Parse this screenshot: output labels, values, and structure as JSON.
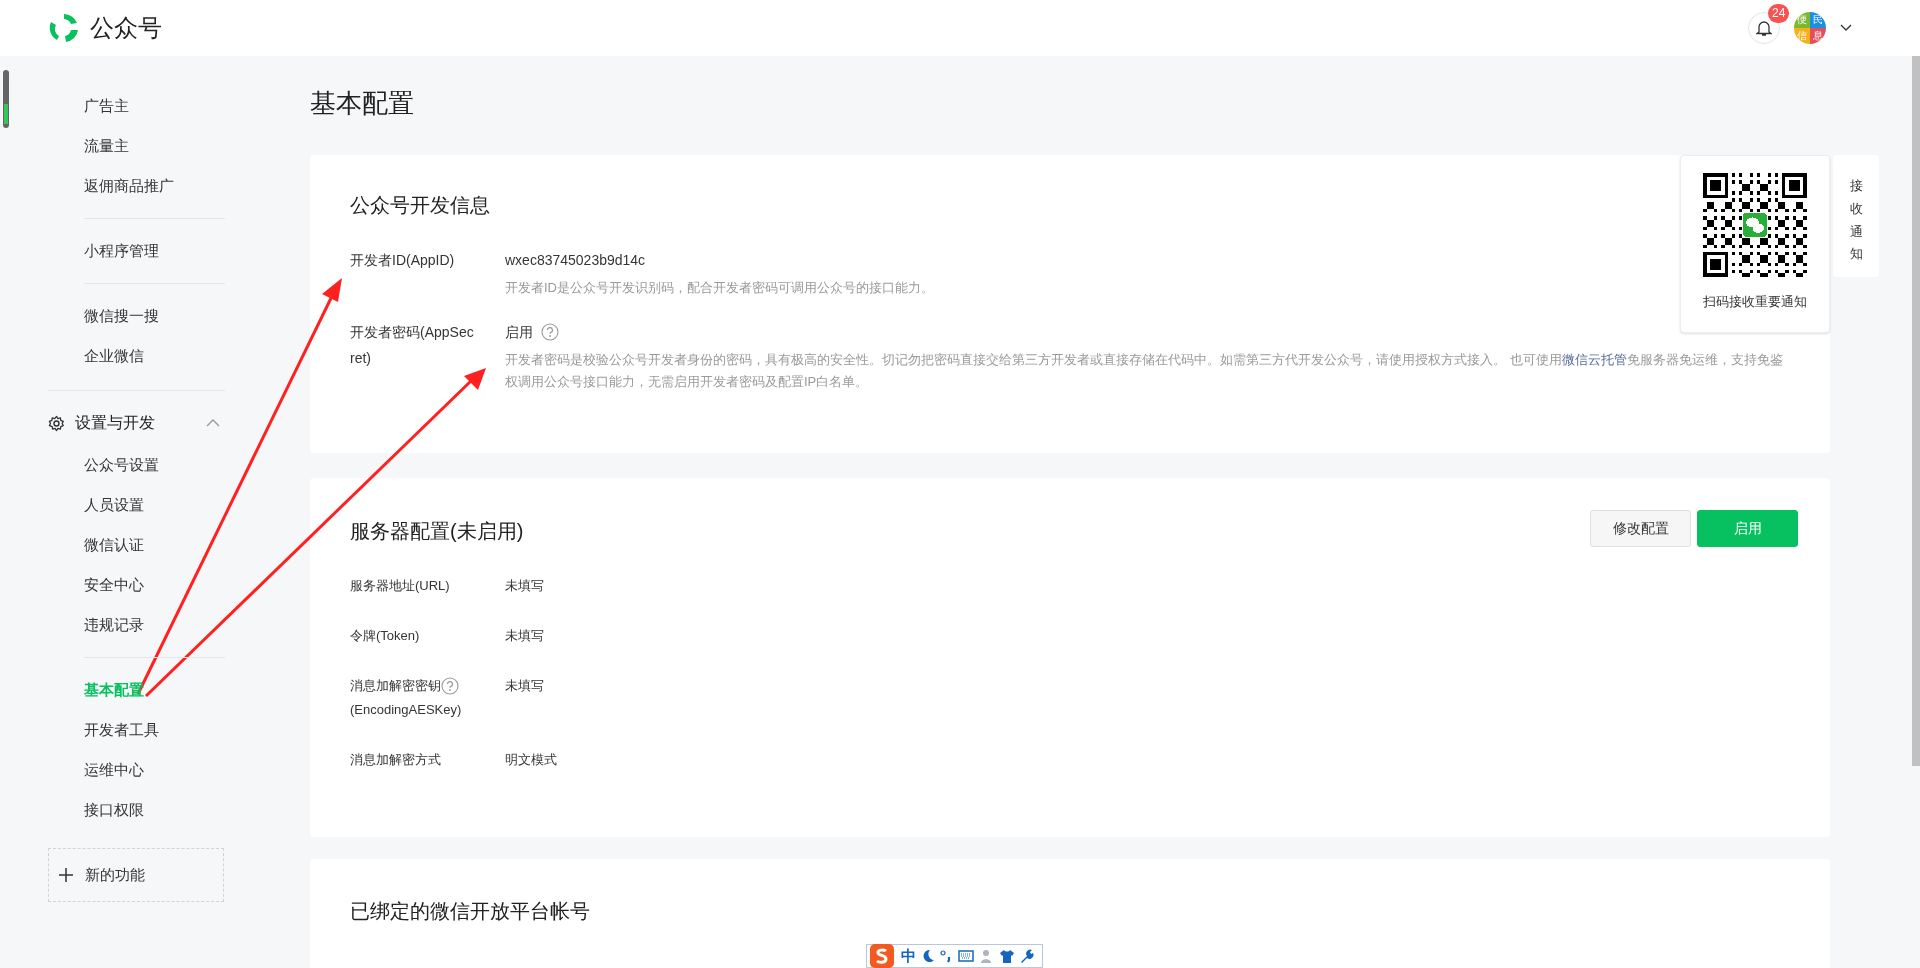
{
  "header": {
    "title": "公众号",
    "notification_count": "24",
    "avatar_chars": [
      "便",
      "民",
      "信",
      "息"
    ]
  },
  "sidebar": {
    "sections": [
      {
        "blocks": [
          [
            {
              "label": "广告主",
              "selected": false
            },
            {
              "label": "流量主",
              "selected": false
            },
            {
              "label": "返佣商品推广",
              "selected": false
            }
          ],
          [
            {
              "label": "小程序管理",
              "selected": false
            }
          ],
          [
            {
              "label": "微信搜一搜",
              "selected": false
            },
            {
              "label": "企业微信",
              "selected": false
            }
          ]
        ]
      },
      {
        "title": "设置与开发",
        "expanded": true,
        "blocks": [
          [
            {
              "label": "公众号设置",
              "selected": false
            },
            {
              "label": "人员设置",
              "selected": false
            },
            {
              "label": "微信认证",
              "selected": false
            },
            {
              "label": "安全中心",
              "selected": false
            },
            {
              "label": "违规记录",
              "selected": false
            }
          ],
          [
            {
              "label": "基本配置",
              "selected": true
            },
            {
              "label": "开发者工具",
              "selected": false
            },
            {
              "label": "运维中心",
              "selected": false
            },
            {
              "label": "接口权限",
              "selected": false
            }
          ]
        ]
      }
    ],
    "new_feature": "新的功能"
  },
  "page_title": "基本配置",
  "dev_info": {
    "title": "公众号开发信息",
    "fields": [
      {
        "label": "开发者ID(AppID)",
        "value": "wxec83745023b9d14c",
        "help": false,
        "description": [
          {
            "text": "开发者ID是公众号开发识别码，配合开发者密码可调用公众号的接口能力。"
          }
        ]
      },
      {
        "label": "开发者密码(AppSecret)",
        "value": "启用",
        "help": true,
        "description": [
          {
            "text": "开发者密码是校验公众号开发者身份的密码，具有极高的安全性。切记勿把密码直接交给第三方开发者或直接存储在代码中。如需第三方代开发公众号，请使用授权方式接入。 也可使用"
          },
          {
            "text": "微信云托管",
            "kind": "link"
          },
          {
            "text": "免服务器免运维，支持免鉴权调用公众号接口能力，无需启用开发者密码及配置IP白名单。"
          }
        ]
      }
    ]
  },
  "qr_panel": {
    "caption": "扫码接收重要通知",
    "side_tab": "接收通知"
  },
  "server_config": {
    "title": "服务器配置(未启用)",
    "buttons": [
      {
        "label": "修改配置",
        "kind": "secondary"
      },
      {
        "label": "启用",
        "kind": "primary"
      }
    ],
    "fields": [
      {
        "label": "服务器地址(URL)",
        "value": "未填写",
        "help": false
      },
      {
        "label": "令牌(Token)",
        "value": "未填写",
        "help": false
      },
      {
        "label": "消息加解密密钥",
        "label_sub": "(EncodingAESKey)",
        "value": "未填写",
        "help": true
      },
      {
        "label": "消息加解密方式",
        "value": "明文模式",
        "help": false
      }
    ]
  },
  "bound_accounts": {
    "title": "已绑定的微信开放平台帐号"
  },
  "ime_toolbar": {
    "label": "中"
  }
}
